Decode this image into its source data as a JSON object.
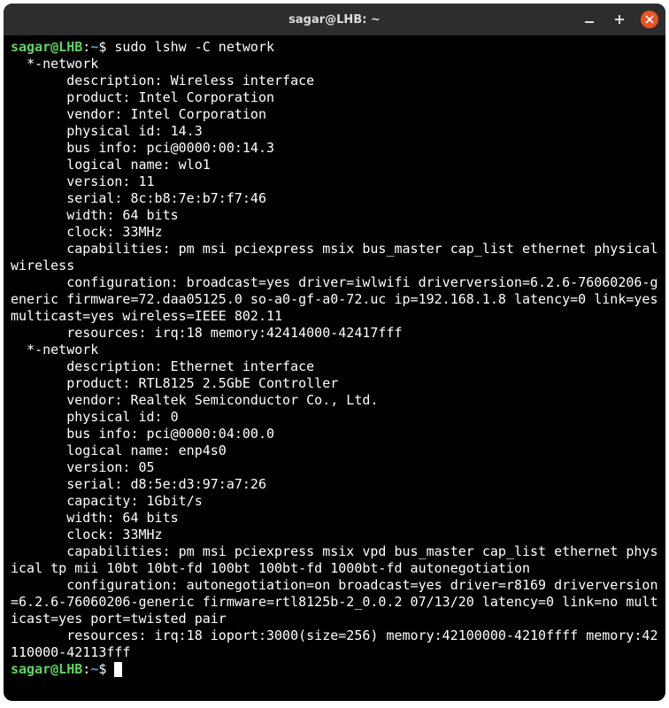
{
  "titlebar": {
    "title": "sagar@LHB: ~"
  },
  "prompt": {
    "user_host": "sagar@LHB",
    "colon": ":",
    "path": "~",
    "dollar": "$"
  },
  "command": " sudo lshw -C network",
  "output": [
    "  *-network",
    "       description: Wireless interface",
    "       product: Intel Corporation",
    "       vendor: Intel Corporation",
    "       physical id: 14.3",
    "       bus info: pci@0000:00:14.3",
    "       logical name: wlo1",
    "       version: 11",
    "       serial: 8c:b8:7e:b7:f7:46",
    "       width: 64 bits",
    "       clock: 33MHz",
    "       capabilities: pm msi pciexpress msix bus_master cap_list ethernet physical wireless",
    "       configuration: broadcast=yes driver=iwlwifi driverversion=6.2.6-76060206-generic firmware=72.daa05125.0 so-a0-gf-a0-72.uc ip=192.168.1.8 latency=0 link=yes multicast=yes wireless=IEEE 802.11",
    "       resources: irq:18 memory:42414000-42417fff",
    "  *-network",
    "       description: Ethernet interface",
    "       product: RTL8125 2.5GbE Controller",
    "       vendor: Realtek Semiconductor Co., Ltd.",
    "       physical id: 0",
    "       bus info: pci@0000:04:00.0",
    "       logical name: enp4s0",
    "       version: 05",
    "       serial: d8:5e:d3:97:a7:26",
    "       capacity: 1Gbit/s",
    "       width: 64 bits",
    "       clock: 33MHz",
    "       capabilities: pm msi pciexpress msix vpd bus_master cap_list ethernet physical tp mii 10bt 10bt-fd 100bt 100bt-fd 1000bt-fd autonegotiation",
    "       configuration: autonegotiation=on broadcast=yes driver=r8169 driverversion=6.2.6-76060206-generic firmware=rtl8125b-2_0.0.2 07/13/20 latency=0 link=no multicast=yes port=twisted pair",
    "       resources: irq:18 ioport:3000(size=256) memory:42100000-4210ffff memory:42110000-42113fff"
  ]
}
